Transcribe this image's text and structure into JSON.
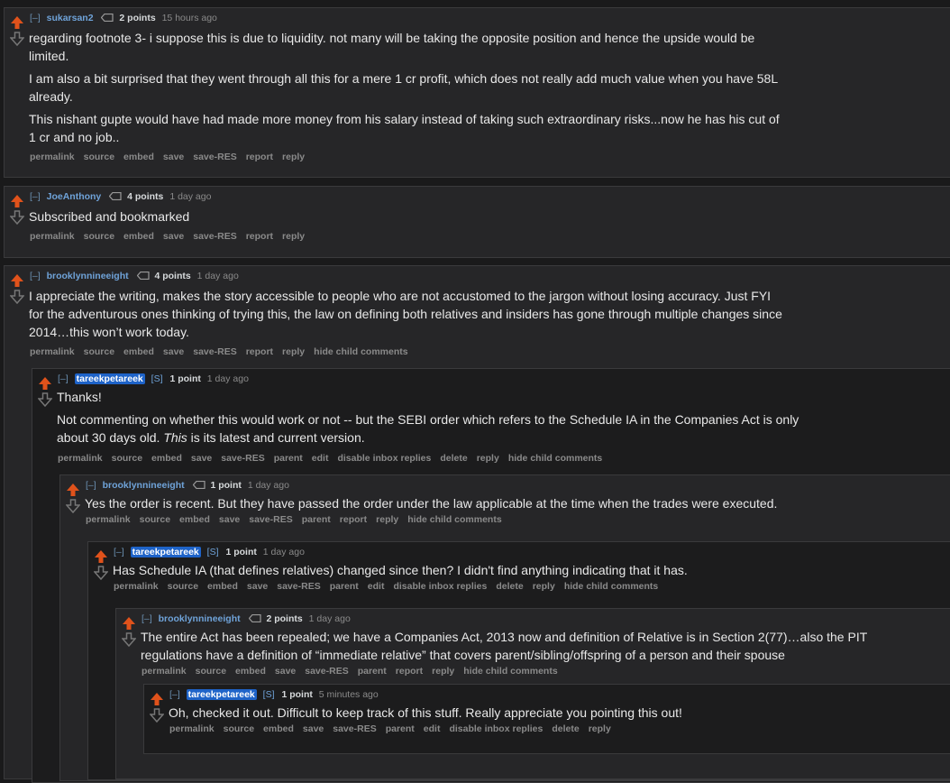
{
  "comments": [
    {
      "expand": "[–]",
      "author": "sukarsan2",
      "score": "2 points",
      "time": "15 hours ago",
      "paragraphs": [
        "regarding footnote 3- i suppose this is due to liquidity. not many will be taking the opposite position and hence the upside would be limited.",
        "I am also a bit surprised that they went through all this for a mere 1 cr profit, which does not really add much value when you have 58L already.",
        "This nishant gupte would have had made more money from his salary instead of taking such extraordinary risks...now he has his cut of 1 cr and no job.."
      ],
      "buttons": [
        "permalink",
        "source",
        "embed",
        "save",
        "save-RES",
        "report",
        "reply"
      ]
    },
    {
      "expand": "[–]",
      "author": "JoeAnthony",
      "score": "4 points",
      "time": "1 day ago",
      "paragraphs": [
        "Subscribed and bookmarked"
      ],
      "buttons": [
        "permalink",
        "source",
        "embed",
        "save",
        "save-RES",
        "report",
        "reply"
      ]
    },
    {
      "expand": "[–]",
      "author": "brooklynnineeight",
      "score": "4 points",
      "time": "1 day ago",
      "paragraphs": [
        "I appreciate the writing, makes the story accessible to people who are not accustomed to the jargon without losing accuracy. Just FYI for the adventurous ones thinking of trying this, the law on defining both relatives and insiders has gone through multiple changes since 2014…this won’t work today."
      ],
      "buttons": [
        "permalink",
        "source",
        "embed",
        "save",
        "save-RES",
        "report",
        "reply",
        "hide child comments"
      ]
    },
    {
      "expand": "[–]",
      "author": "tareekpetareek",
      "submitter_flag": "[S]",
      "score": "1 point",
      "time": "1 day ago",
      "paragraphs": [
        "Thanks!"
      ],
      "italic_para": {
        "before": "Not commenting on whether this would work or not -- but the SEBI order which refers to the Schedule IA in the Companies Act is only about 30 days old. ",
        "em": "This",
        "after": " is its latest and current version."
      },
      "buttons": [
        "permalink",
        "source",
        "embed",
        "save",
        "save-RES",
        "parent",
        "edit",
        "disable inbox replies",
        "delete",
        "reply",
        "hide child comments"
      ]
    },
    {
      "expand": "[–]",
      "author": "brooklynnineeight",
      "score": "1 point",
      "time": "1 day ago",
      "paragraphs": [
        "Yes the order is recent. But they have passed the order under the law applicable at the time when the trades were executed."
      ],
      "buttons": [
        "permalink",
        "source",
        "embed",
        "save",
        "save-RES",
        "parent",
        "report",
        "reply",
        "hide child comments"
      ]
    },
    {
      "expand": "[–]",
      "author": "tareekpetareek",
      "submitter_flag": "[S]",
      "score": "1 point",
      "time": "1 day ago",
      "paragraphs": [
        "Has Schedule IA (that defines relatives) changed since then? I didn't find anything indicating that it has."
      ],
      "buttons": [
        "permalink",
        "source",
        "embed",
        "save",
        "save-RES",
        "parent",
        "edit",
        "disable inbox replies",
        "delete",
        "reply",
        "hide child comments"
      ]
    },
    {
      "expand": "[–]",
      "author": "brooklynnineeight",
      "score": "2 points",
      "time": "1 day ago",
      "paragraphs": [
        "The entire Act has been repealed; we have a Companies Act, 2013 now and definition of Relative is in Section 2(77)…also the PIT regulations have a definition of “immediate relative” that covers parent/sibling/offspring of a person and their spouse"
      ],
      "buttons": [
        "permalink",
        "source",
        "embed",
        "save",
        "save-RES",
        "parent",
        "report",
        "reply",
        "hide child comments"
      ]
    },
    {
      "expand": "[–]",
      "author": "tareekpetareek",
      "submitter_flag": "[S]",
      "score": "1 point",
      "time": "5 minutes ago",
      "paragraphs": [
        "Oh, checked it out. Difficult to keep track of this stuff. Really appreciate you pointing this out!"
      ],
      "buttons": [
        "permalink",
        "source",
        "embed",
        "save",
        "save-RES",
        "parent",
        "edit",
        "disable inbox replies",
        "delete",
        "reply"
      ]
    }
  ],
  "colors": {
    "upvote": "#e0521b",
    "downvote": "#777777",
    "op_badge": "#1e63c8"
  },
  "icons": {
    "upvote": "upvote-arrow-icon",
    "downvote": "downvote-arrow-icon",
    "score": "tag-icon"
  }
}
